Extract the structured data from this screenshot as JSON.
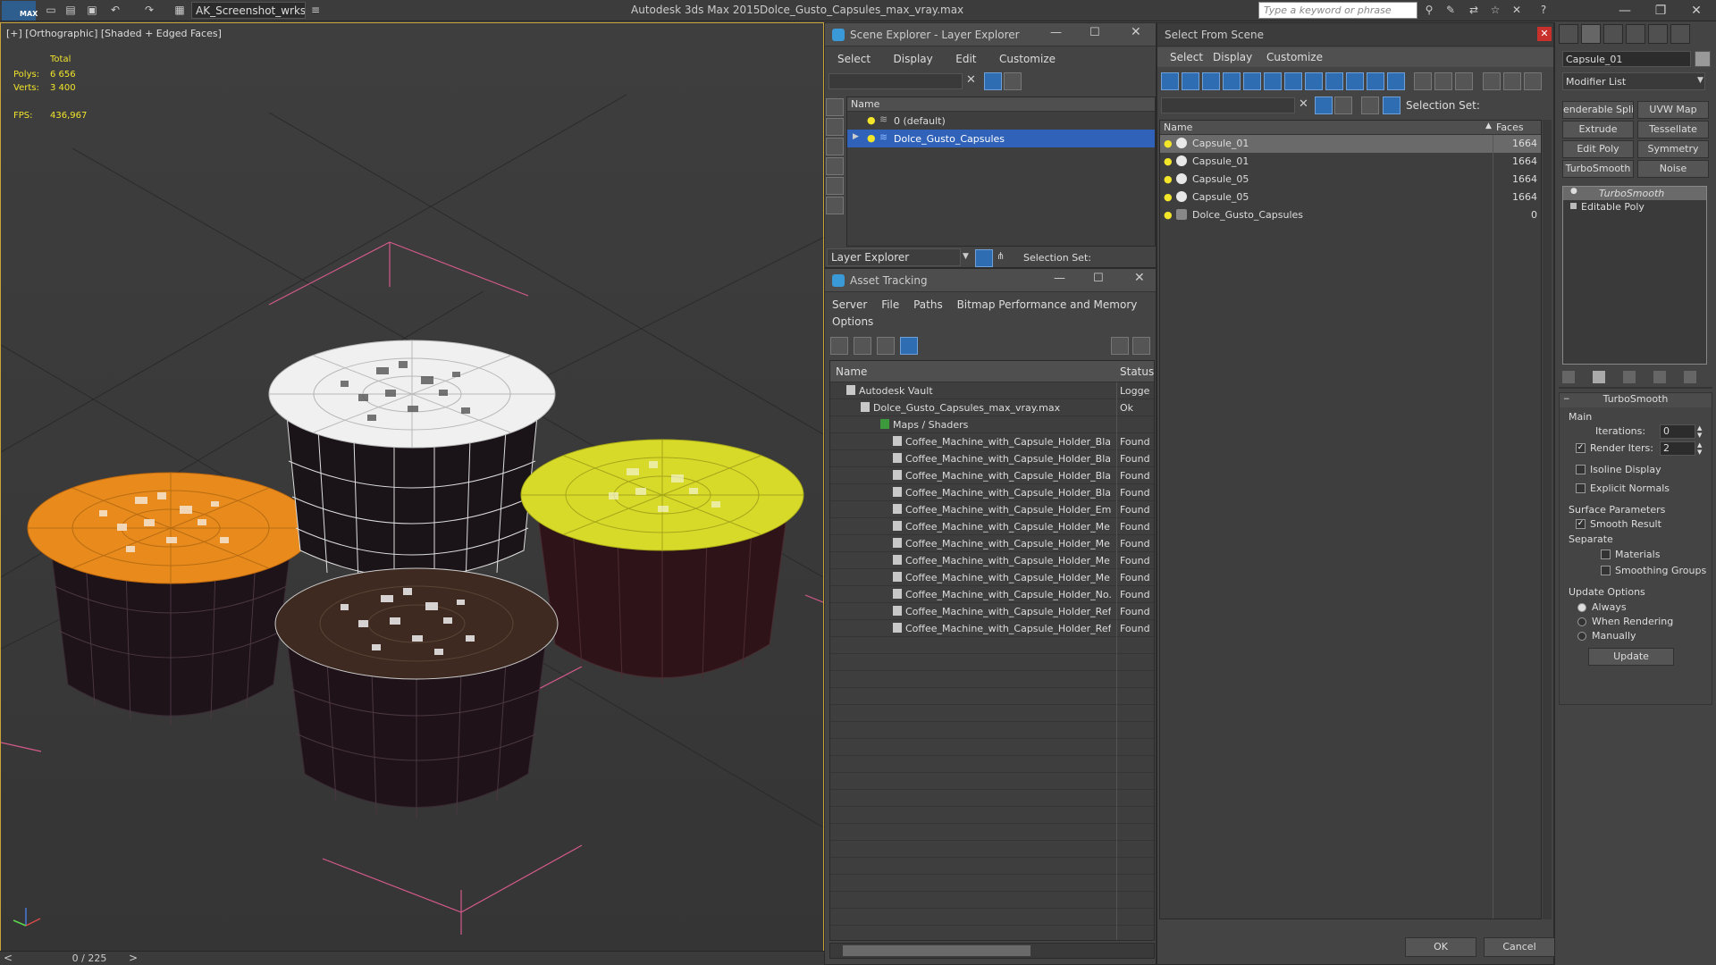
{
  "titlebar": {
    "logo": "MAX",
    "workspace": "AK_Screenshot_wrksp",
    "app_title": "Autodesk 3ds Max  2015",
    "file_title": "Dolce_Gusto_Capsules_max_vray.max",
    "search_placeholder": "Type a keyword or phrase"
  },
  "viewport": {
    "label": "[+] [Orthographic] [Shaded + Edged Faces]",
    "stats": {
      "total_label": "Total",
      "polys_label": "Polys:",
      "polys_value": "6 656",
      "verts_label": "Verts:",
      "verts_value": "3 400",
      "fps_label": "FPS:",
      "fps_value": "436,967"
    },
    "colors": {
      "orange": "#e88a1c",
      "yellow": "#d8da2a",
      "white": "#e8e8e8",
      "brown": "#3e2a20",
      "cup": "#2a1a1e"
    }
  },
  "timeline": {
    "frame": "0 / 225",
    "prev": "<",
    "next": ">"
  },
  "scene_explorer": {
    "title": "Scene Explorer - Layer Explorer",
    "menus": [
      "Select",
      "Display",
      "Edit",
      "Customize"
    ],
    "column": "Name",
    "layers": [
      {
        "name": "0 (default)",
        "selected": false
      },
      {
        "name": "Dolce_Gusto_Capsules",
        "selected": true
      }
    ],
    "footer_dropdown": "Layer Explorer",
    "selection_set": "Selection Set:"
  },
  "asset_tracking": {
    "title": "Asset Tracking",
    "menus": [
      "Server",
      "File",
      "Paths",
      "Bitmap Performance and Memory",
      "Options"
    ],
    "col_name": "Name",
    "col_status": "Status",
    "rows": [
      {
        "name": "Autodesk Vault",
        "status": "Logge",
        "indent": 1
      },
      {
        "name": "Dolce_Gusto_Capsules_max_vray.max",
        "status": "Ok",
        "indent": 2
      },
      {
        "name": "Maps / Shaders",
        "status": "",
        "indent": 3
      },
      {
        "name": "Coffee_Machine_with_Capsule_Holder_Bla...",
        "status": "Found",
        "indent": 4
      },
      {
        "name": "Coffee_Machine_with_Capsule_Holder_Bla...",
        "status": "Found",
        "indent": 4
      },
      {
        "name": "Coffee_Machine_with_Capsule_Holder_Bla...",
        "status": "Found",
        "indent": 4
      },
      {
        "name": "Coffee_Machine_with_Capsule_Holder_Bla...",
        "status": "Found",
        "indent": 4
      },
      {
        "name": "Coffee_Machine_with_Capsule_Holder_Em...",
        "status": "Found",
        "indent": 4
      },
      {
        "name": "Coffee_Machine_with_Capsule_Holder_Me...",
        "status": "Found",
        "indent": 4
      },
      {
        "name": "Coffee_Machine_with_Capsule_Holder_Me...",
        "status": "Found",
        "indent": 4
      },
      {
        "name": "Coffee_Machine_with_Capsule_Holder_Me...",
        "status": "Found",
        "indent": 4
      },
      {
        "name": "Coffee_Machine_with_Capsule_Holder_Me...",
        "status": "Found",
        "indent": 4
      },
      {
        "name": "Coffee_Machine_with_Capsule_Holder_No...",
        "status": "Found",
        "indent": 4
      },
      {
        "name": "Coffee_Machine_with_Capsule_Holder_Ref...",
        "status": "Found",
        "indent": 4
      },
      {
        "name": "Coffee_Machine_with_Capsule_Holder_Ref...",
        "status": "Found",
        "indent": 4
      }
    ]
  },
  "select_from_scene": {
    "title": "Select From Scene",
    "menus": [
      "Select",
      "Display",
      "Customize"
    ],
    "selection_set": "Selection Set:",
    "col_name": "Name",
    "col_faces": "Faces",
    "rows": [
      {
        "name": "Capsule_01",
        "faces": "1664",
        "selected": true
      },
      {
        "name": "Capsule_01",
        "faces": "1664",
        "selected": false
      },
      {
        "name": "Capsule_05",
        "faces": "1664",
        "selected": false
      },
      {
        "name": "Capsule_05",
        "faces": "1664",
        "selected": false
      },
      {
        "name": "Dolce_Gusto_Capsules",
        "faces": "0",
        "selected": false
      }
    ],
    "ok": "OK",
    "cancel": "Cancel"
  },
  "command_panel": {
    "object_name": "Capsule_01",
    "modifier_list": "Modifier List",
    "buttons": [
      "enderable Splir",
      "UVW Map",
      "Extrude",
      "Tessellate",
      "Edit Poly",
      "Symmetry",
      "TurboSmooth",
      "Noise"
    ],
    "stack": [
      "TurboSmooth",
      "Editable Poly"
    ],
    "rollout_title": "TurboSmooth",
    "main_label": "Main",
    "iterations_label": "Iterations:",
    "iterations_value": "0",
    "render_iters_label": "Render Iters:",
    "render_iters_value": "2",
    "isoline": "Isoline Display",
    "explicit_normals": "Explicit Normals",
    "surface_params": "Surface Parameters",
    "smooth_result": "Smooth Result",
    "separate": "Separate",
    "materials": "Materials",
    "smoothing_groups": "Smoothing Groups",
    "update_options": "Update Options",
    "always": "Always",
    "when_rendering": "When Rendering",
    "manually": "Manually",
    "update_btn": "Update"
  }
}
